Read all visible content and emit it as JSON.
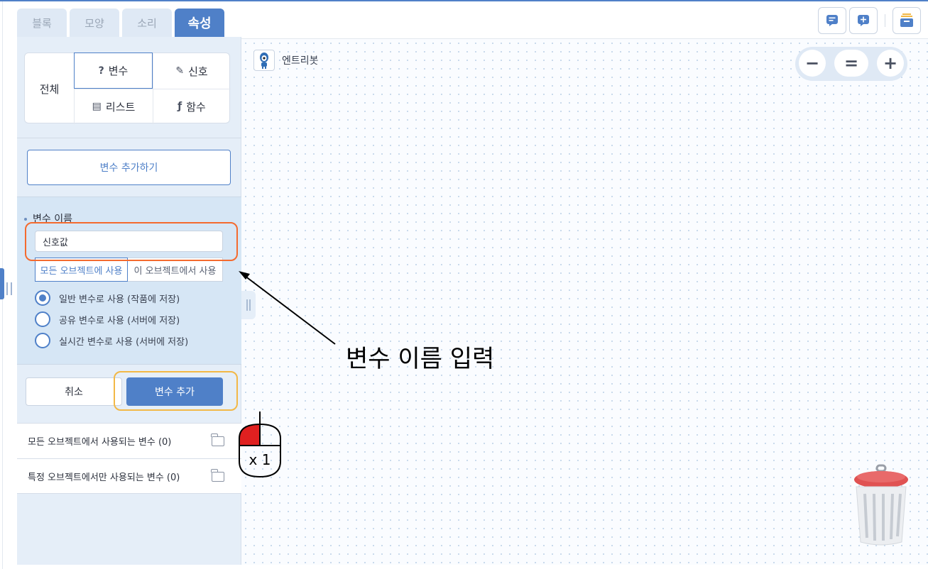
{
  "tabs": [
    {
      "label": "블록"
    },
    {
      "label": "모양"
    },
    {
      "label": "소리"
    },
    {
      "label": "속성"
    }
  ],
  "active_tab": "속성",
  "categories": {
    "all": "전체",
    "items": [
      {
        "icon": "?",
        "label": "변수"
      },
      {
        "icon": "✎",
        "label": "신호"
      },
      {
        "icon": "▤",
        "label": "리스트"
      },
      {
        "icon": "ƒ",
        "label": "함수"
      }
    ]
  },
  "add_variable_button": "변수 추가하기",
  "form": {
    "name_label": "변수 이름",
    "name_value": "신호값",
    "scope_all": "모든 오브젝트에 사용",
    "scope_this": "이 오브젝트에서 사용",
    "radios": [
      {
        "label": "일반 변수로 사용 (작품에 저장)",
        "checked": true
      },
      {
        "label": "공유 변수로 사용 (서버에 저장)",
        "checked": false
      },
      {
        "label": "실시간 변수로 사용 (서버에 저장)",
        "checked": false
      }
    ],
    "cancel": "취소",
    "confirm": "변수 추가"
  },
  "lists": [
    {
      "label": "모든 오브젝트에서 사용되는 변수 (0)"
    },
    {
      "label": "특정 오브젝트에서만 사용되는 변수 (0)"
    }
  ],
  "canvas": {
    "object_name": "엔트리봇",
    "zoom_out": "−",
    "zoom_reset": "=",
    "zoom_in": "+"
  },
  "annotation": {
    "callout": "변수 이름 입력",
    "click_count": "x 1"
  },
  "colors": {
    "accent": "#4f80c8",
    "highlight_name": "#f46a2e",
    "highlight_button": "#f2b846",
    "mouse_red": "#e02020"
  },
  "icons": [
    "comment-icon",
    "add-comment-icon",
    "archive-icon",
    "trash-icon",
    "mouse-icon",
    "folder-icon"
  ]
}
